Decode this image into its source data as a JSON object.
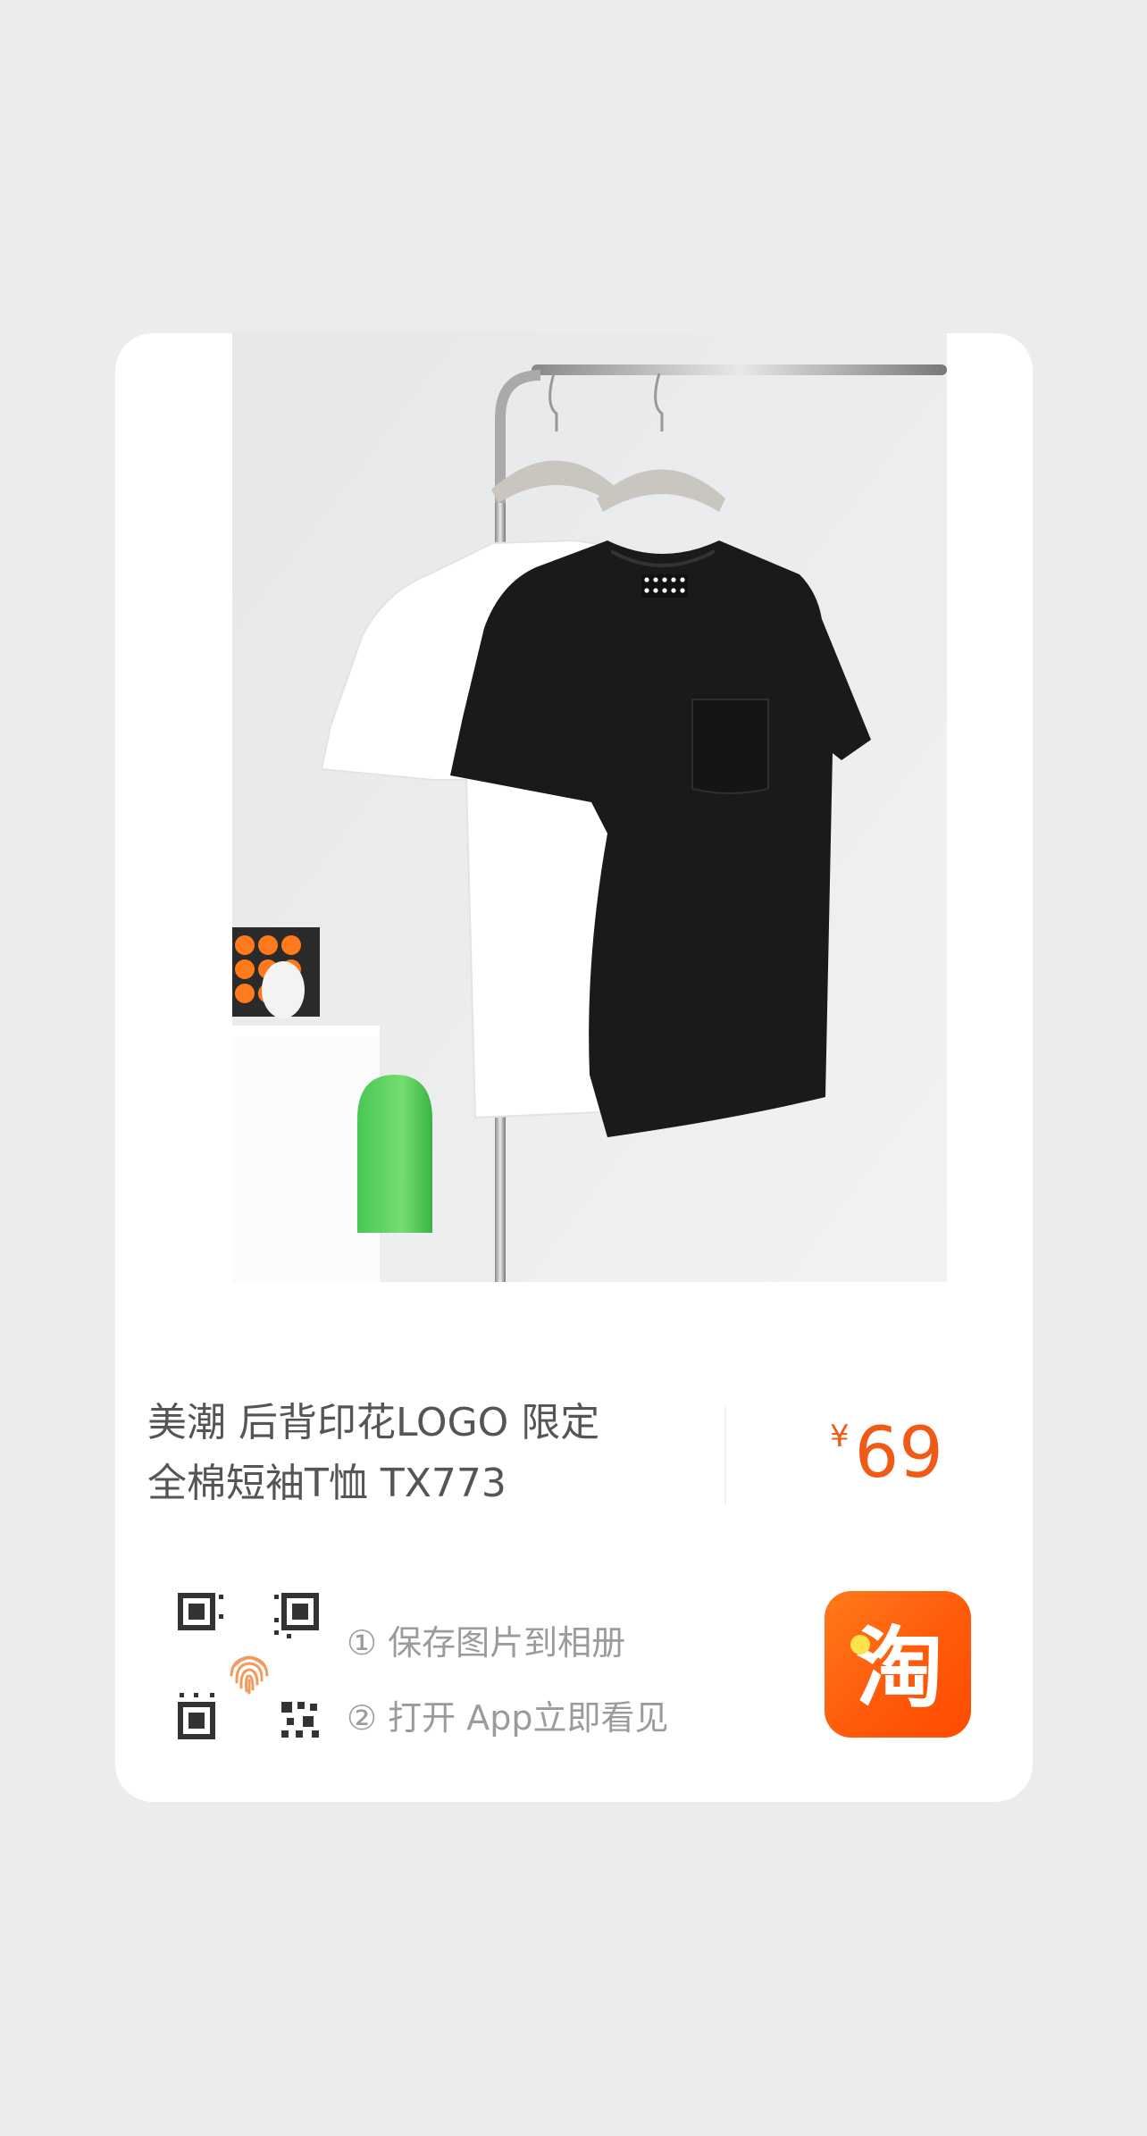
{
  "product": {
    "title_line1": "美潮 后背印花LOGO 限定",
    "title_line2": "全棉短袖T恤 TX773",
    "currency": "¥",
    "price": "69"
  },
  "instructions": {
    "step1": "① 保存图片到相册",
    "step2": "② 打开 App立即看见"
  },
  "icons": {
    "qr": "qr-code-icon",
    "fingerprint": "fingerprint-icon",
    "app": "taobao-app-icon",
    "app_glyph": "淘"
  },
  "colors": {
    "accent": "#f05a16",
    "app_bg": "#ff5a0a",
    "page_bg": "#ececec"
  }
}
